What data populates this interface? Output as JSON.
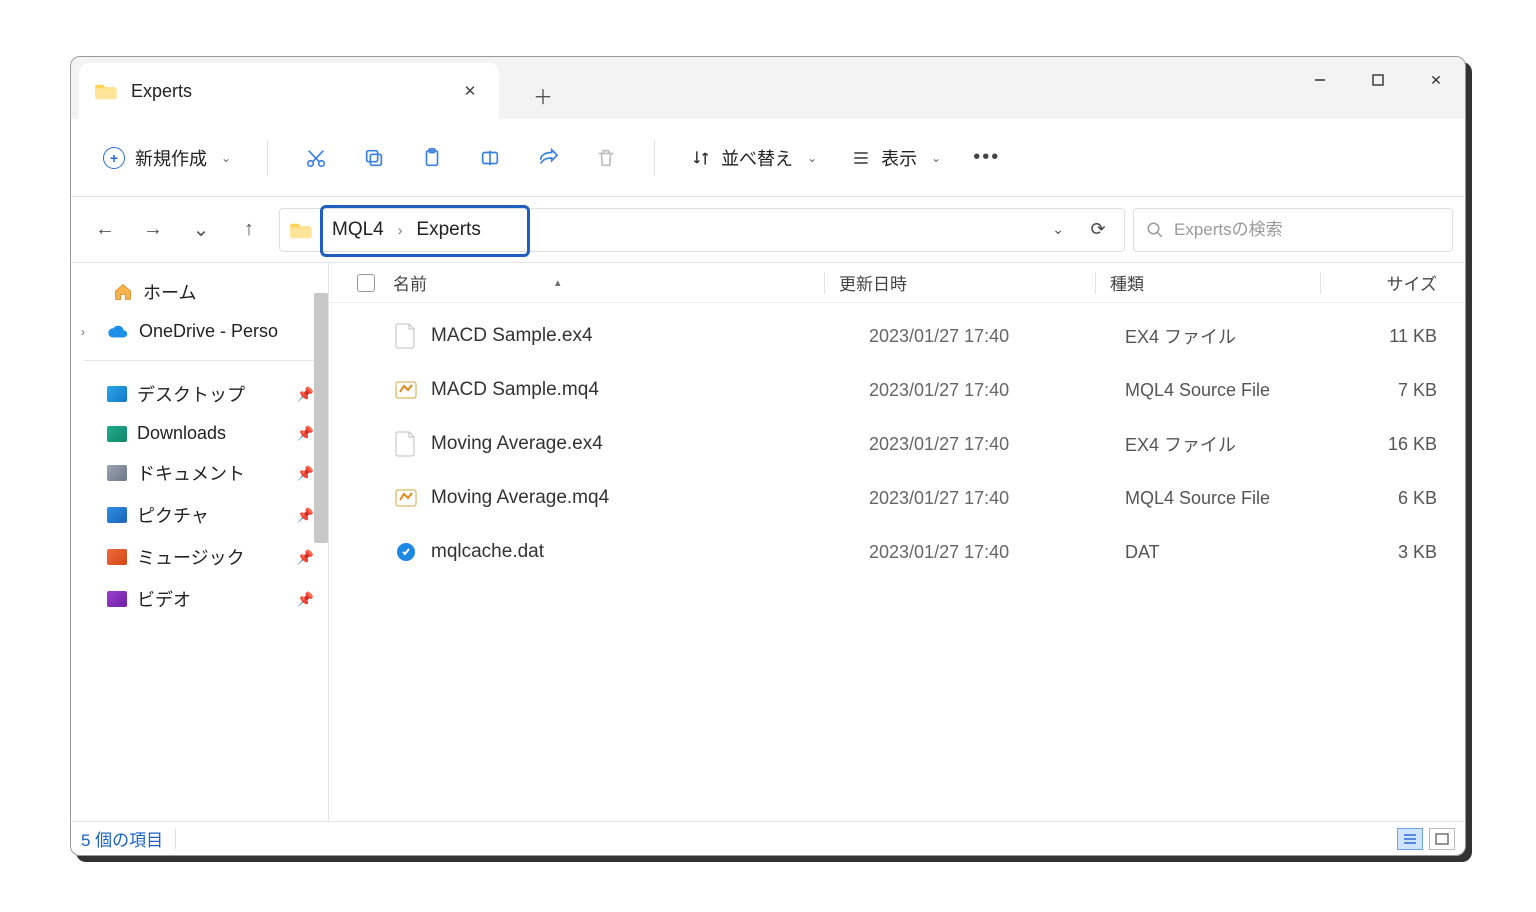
{
  "tab": {
    "title": "Experts"
  },
  "toolbar": {
    "new_label": "新規作成",
    "sort_label": "並べ替え",
    "view_label": "表示"
  },
  "breadcrumb": {
    "parts": [
      "MQL4",
      "Experts"
    ]
  },
  "search": {
    "placeholder": "Expertsの検索"
  },
  "sidebar": {
    "home": "ホーム",
    "onedrive": "OneDrive - Perso",
    "quick": {
      "desktop": "デスクトップ",
      "downloads": "Downloads",
      "documents": "ドキュメント",
      "pictures": "ピクチャ",
      "music": "ミュージック",
      "videos": "ビデオ"
    }
  },
  "columns": {
    "name": "名前",
    "date": "更新日時",
    "type": "種類",
    "size": "サイズ"
  },
  "files": [
    {
      "name": "MACD Sample.ex4",
      "date": "2023/01/27 17:40",
      "type": "EX4 ファイル",
      "size": "11 KB",
      "icon": "ex4"
    },
    {
      "name": "MACD Sample.mq4",
      "date": "2023/01/27 17:40",
      "type": "MQL4 Source File",
      "size": "7 KB",
      "icon": "mq4"
    },
    {
      "name": "Moving Average.ex4",
      "date": "2023/01/27 17:40",
      "type": "EX4 ファイル",
      "size": "16 KB",
      "icon": "ex4"
    },
    {
      "name": "Moving Average.mq4",
      "date": "2023/01/27 17:40",
      "type": "MQL4 Source File",
      "size": "6 KB",
      "icon": "mq4"
    },
    {
      "name": "mqlcache.dat",
      "date": "2023/01/27 17:40",
      "type": "DAT",
      "size": "3 KB",
      "icon": "dat"
    }
  ],
  "status": {
    "count_text": "5 個の項目"
  }
}
